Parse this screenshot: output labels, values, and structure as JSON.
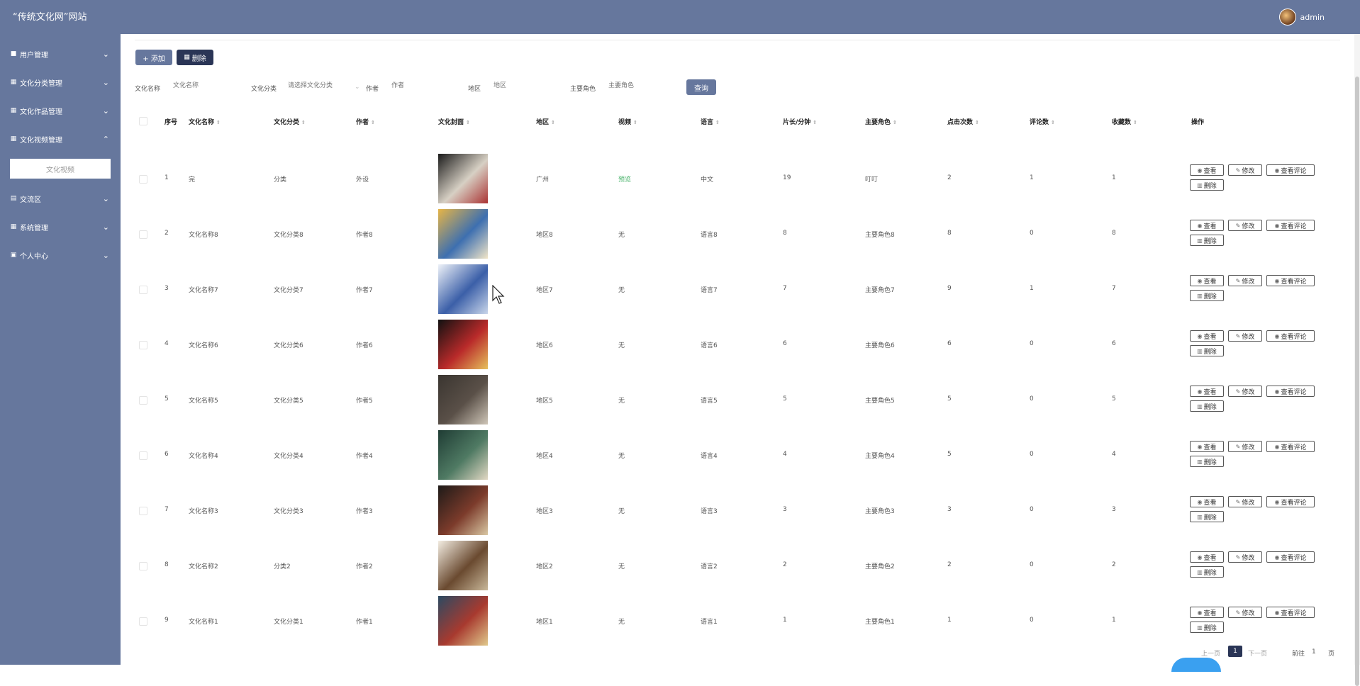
{
  "header": {
    "site_title": "“传统文化网”网站",
    "username": "admin"
  },
  "sidebar": {
    "items": [
      {
        "label": "用户管理",
        "icon": "user-icon"
      },
      {
        "label": "文化分类管理",
        "icon": "grid-icon"
      },
      {
        "label": "文化作品管理",
        "icon": "grid-icon"
      },
      {
        "label": "文化视频管理",
        "icon": "grid-icon",
        "expanded": true
      },
      {
        "label": "交流区",
        "icon": "doc-icon"
      },
      {
        "label": "系统管理",
        "icon": "grid-icon"
      },
      {
        "label": "个人中心",
        "icon": "card-icon"
      }
    ],
    "submenu_item": "文化视频"
  },
  "toolbar": {
    "add_label": "+ 添加",
    "delete_label": "删除"
  },
  "filters": {
    "name_label": "文化名称",
    "name_placeholder": "文化名称",
    "category_label": "文化分类",
    "category_placeholder": "请选择文化分类",
    "author_label": "作者",
    "author_placeholder": "作者",
    "region_label": "地区",
    "region_placeholder": "地区",
    "role_label": "主要角色",
    "role_placeholder": "主要角色",
    "query_label": "查询"
  },
  "table": {
    "columns": [
      "序号",
      "文化名称",
      "文化分类",
      "作者",
      "文化封面",
      "地区",
      "视频",
      "语言",
      "片长/分钟",
      "主要角色",
      "点击次数",
      "评论数",
      "收藏数",
      "操作"
    ],
    "rows": [
      {
        "idx": "1",
        "name": "完",
        "category": "分类",
        "author": "外设",
        "region": "广州",
        "video": "预览",
        "language": "中文",
        "duration": "19",
        "role": "叮叮",
        "clicks": "2",
        "comments": "1",
        "favorites": "1"
      },
      {
        "idx": "2",
        "name": "文化名称8",
        "category": "文化分类8",
        "author": "作者8",
        "region": "地区8",
        "video": "无",
        "language": "语言8",
        "duration": "8",
        "role": "主要角色8",
        "clicks": "8",
        "comments": "0",
        "favorites": "8"
      },
      {
        "idx": "3",
        "name": "文化名称7",
        "category": "文化分类7",
        "author": "作者7",
        "region": "地区7",
        "video": "无",
        "language": "语言7",
        "duration": "7",
        "role": "主要角色7",
        "clicks": "9",
        "comments": "1",
        "favorites": "7"
      },
      {
        "idx": "4",
        "name": "文化名称6",
        "category": "文化分类6",
        "author": "作者6",
        "region": "地区6",
        "video": "无",
        "language": "语言6",
        "duration": "6",
        "role": "主要角色6",
        "clicks": "6",
        "comments": "0",
        "favorites": "6"
      },
      {
        "idx": "5",
        "name": "文化名称5",
        "category": "文化分类5",
        "author": "作者5",
        "region": "地区5",
        "video": "无",
        "language": "语言5",
        "duration": "5",
        "role": "主要角色5",
        "clicks": "5",
        "comments": "0",
        "favorites": "5"
      },
      {
        "idx": "6",
        "name": "文化名称4",
        "category": "文化分类4",
        "author": "作者4",
        "region": "地区4",
        "video": "无",
        "language": "语言4",
        "duration": "4",
        "role": "主要角色4",
        "clicks": "5",
        "comments": "0",
        "favorites": "4"
      },
      {
        "idx": "7",
        "name": "文化名称3",
        "category": "文化分类3",
        "author": "作者3",
        "region": "地区3",
        "video": "无",
        "language": "语言3",
        "duration": "3",
        "role": "主要角色3",
        "clicks": "3",
        "comments": "0",
        "favorites": "3"
      },
      {
        "idx": "8",
        "name": "文化名称2",
        "category": "分类2",
        "author": "作者2",
        "region": "地区2",
        "video": "无",
        "language": "语言2",
        "duration": "2",
        "role": "主要角色2",
        "clicks": "2",
        "comments": "0",
        "favorites": "2"
      },
      {
        "idx": "9",
        "name": "文化名称1",
        "category": "文化分类1",
        "author": "作者1",
        "region": "地区1",
        "video": "无",
        "language": "语言1",
        "duration": "1",
        "role": "主要角色1",
        "clicks": "1",
        "comments": "0",
        "favorites": "1"
      }
    ],
    "actions": {
      "view": "查看",
      "edit": "修改",
      "view_comments": "查看评论",
      "delete": "删除"
    }
  },
  "pagination": {
    "prev": "上一页",
    "current": "1",
    "next": "下一页",
    "goto": "前往",
    "page_value": "1",
    "page_suffix": "页"
  },
  "colors": {
    "primary": "#66779d",
    "dark": "#2a3556",
    "green": "#49b36b"
  }
}
